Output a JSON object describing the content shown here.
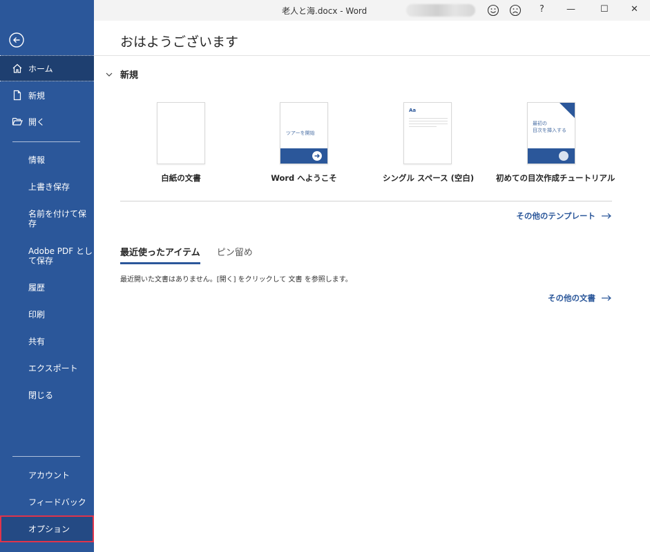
{
  "window": {
    "title": "老人と海.docx  -  Word",
    "help_label": "?",
    "minimize_label": "—",
    "maximize_label": "☐",
    "close_label": "✕"
  },
  "sidebar": {
    "back_icon": "back-arrow-icon",
    "items_top": [
      {
        "label": "ホーム",
        "icon": "home-icon"
      },
      {
        "label": "新規",
        "icon": "new-document-icon"
      },
      {
        "label": "開く",
        "icon": "folder-open-icon"
      }
    ],
    "items_mid": [
      {
        "label": "情報"
      },
      {
        "label": "上書き保存"
      },
      {
        "label": "名前を付けて保\n存"
      },
      {
        "label": "Adobe PDF とし\nて保存"
      },
      {
        "label": "履歴"
      },
      {
        "label": "印刷"
      },
      {
        "label": "共有"
      },
      {
        "label": "エクスポート"
      },
      {
        "label": "閉じる"
      }
    ],
    "items_bottom": [
      {
        "label": "アカウント"
      },
      {
        "label": "フィードバック"
      },
      {
        "label": "オプション"
      }
    ]
  },
  "main": {
    "greeting": "おはようございます",
    "new_section": "新規",
    "templates": [
      {
        "label": "白紙の文書"
      },
      {
        "label": "Word へようこそ",
        "thumb_text": "ツアーを開始"
      },
      {
        "label": "シングル スペース (空白)",
        "thumb_text": "Aa"
      },
      {
        "label": "初めての目次作成チュートリアル",
        "thumb_text": "最初の\n目次を挿入する"
      }
    ],
    "more_templates": "その他のテンプレート",
    "tabs": [
      {
        "label": "最近使ったアイテム",
        "active": true
      },
      {
        "label": "ピン留め",
        "active": false
      }
    ],
    "recent_message": "最近開いた文書はありません。[開く] をクリックして 文書 を参照します。",
    "more_documents": "その他の文書"
  },
  "colors": {
    "brand": "#2b579a",
    "highlight": "#e0344b"
  }
}
